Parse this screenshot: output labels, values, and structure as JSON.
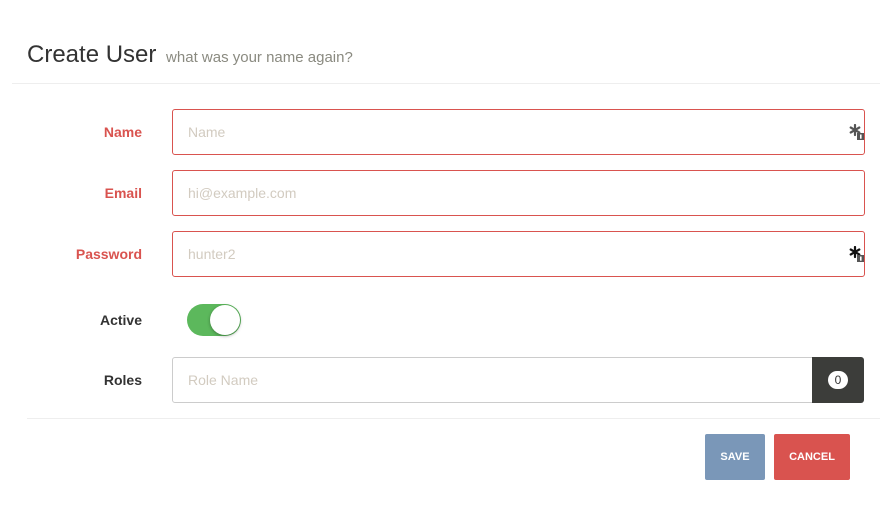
{
  "header": {
    "title": "Create User",
    "subtitle": "what was your name again?"
  },
  "form": {
    "name": {
      "label": "Name",
      "placeholder": "Name",
      "value": ""
    },
    "email": {
      "label": "Email",
      "placeholder": "hi@example.com",
      "value": ""
    },
    "password": {
      "label": "Password",
      "placeholder": "hunter2",
      "value": ""
    },
    "active": {
      "label": "Active",
      "on": true
    },
    "roles": {
      "label": "Roles",
      "placeholder": "Role Name",
      "count": "0"
    }
  },
  "actions": {
    "save_label": "SAVE",
    "cancel_label": "CANCEL"
  },
  "colors": {
    "error": "#d9534f",
    "toggle_on": "#5cb85c",
    "save_button": "#7a97b8",
    "cancel_button": "#d9534f",
    "roles_addon": "#3c3d3a"
  },
  "icons": {
    "required": "required-asterisk-icon"
  }
}
